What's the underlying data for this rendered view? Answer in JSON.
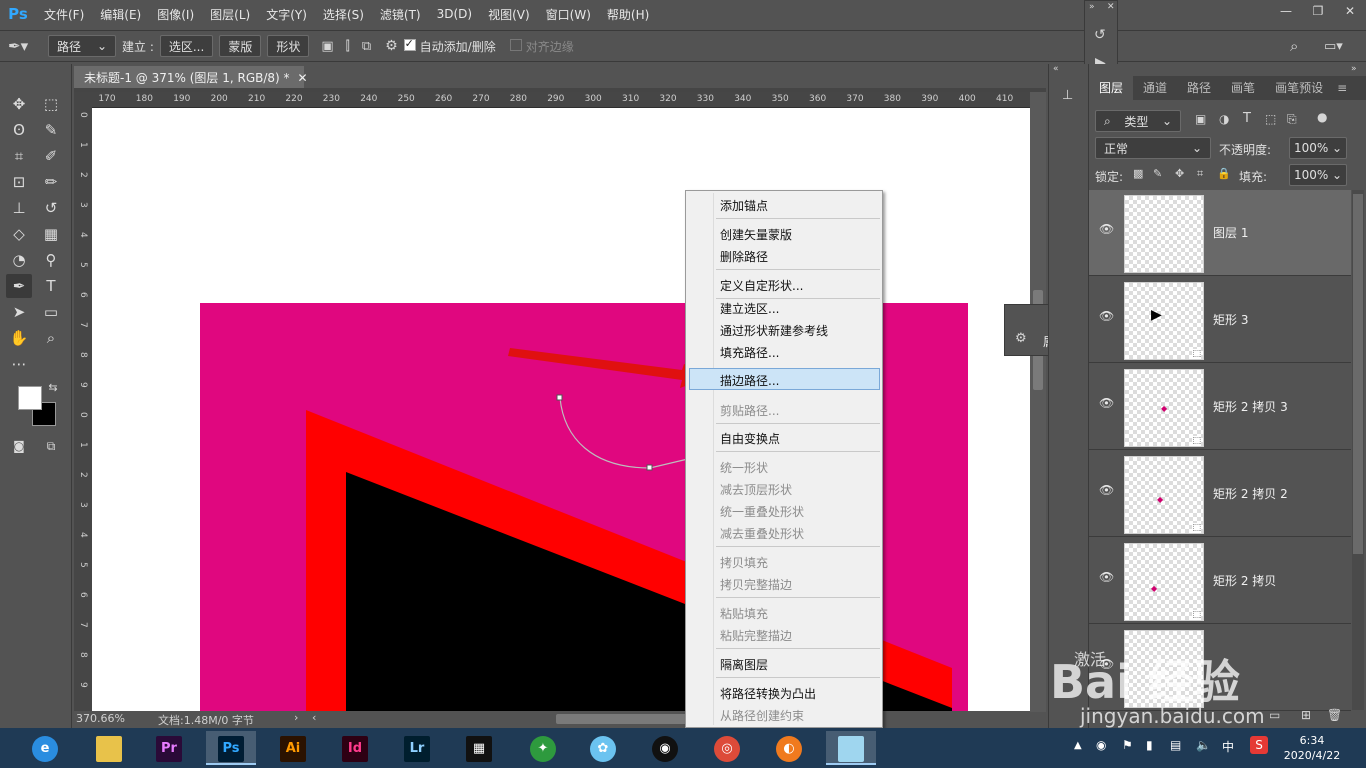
{
  "app": {
    "logo": "Ps"
  },
  "menubar": {
    "items": [
      "文件(F)",
      "编辑(E)",
      "图像(I)",
      "图层(L)",
      "文字(Y)",
      "选择(S)",
      "滤镜(T)",
      "3D(D)",
      "视图(V)",
      "窗口(W)",
      "帮助(H)"
    ]
  },
  "window_controls": {
    "minimize": "—",
    "restore": "❐",
    "close": "✕"
  },
  "options": {
    "mode": "路径",
    "make_label": "建立 :",
    "selection_btn": "选区...",
    "mask_btn": "蒙版",
    "shape_btn": "形状",
    "auto_add_delete": "自动添加/删除",
    "align_edges": "对齐边缘"
  },
  "document": {
    "tab_title": "未标题-1 @ 371% (图层 1, RGB/8) *",
    "zoom": "370.66%",
    "doc_info": "文档:1.48M/0 字节",
    "ruler_h": [
      "170",
      "180",
      "190",
      "200",
      "210",
      "220",
      "230",
      "240",
      "250",
      "260",
      "270",
      "280",
      "290",
      "300",
      "310",
      "320",
      "330",
      "340",
      "350",
      "360",
      "370",
      "380",
      "390",
      "400",
      "410"
    ],
    "ruler_v": [
      "0",
      "1",
      "2",
      "3",
      "4",
      "5",
      "6",
      "7",
      "8",
      "9",
      "0",
      "1",
      "2",
      "3",
      "4",
      "5",
      "6",
      "7",
      "8",
      "9"
    ]
  },
  "context_menu": {
    "items": [
      {
        "label": "添加锚点",
        "disabled": false
      },
      {
        "label": "创建矢量蒙版",
        "disabled": false
      },
      {
        "label": "删除路径",
        "disabled": false
      },
      {
        "label": "定义自定形状...",
        "disabled": false
      },
      {
        "label": "建立选区...",
        "disabled": false
      },
      {
        "label": "通过形状新建参考线",
        "disabled": false
      },
      {
        "label": "填充路径...",
        "disabled": false
      },
      {
        "label": "描边路径...",
        "disabled": false,
        "highlighted": true
      },
      {
        "label": "剪贴路径...",
        "disabled": true
      },
      {
        "label": "自由变换点",
        "disabled": false
      },
      {
        "label": "统一形状",
        "disabled": true
      },
      {
        "label": "减去顶层形状",
        "disabled": true
      },
      {
        "label": "统一重叠处形状",
        "disabled": true
      },
      {
        "label": "减去重叠处形状",
        "disabled": true
      },
      {
        "label": "拷贝填充",
        "disabled": true
      },
      {
        "label": "拷贝完整描边",
        "disabled": true
      },
      {
        "label": "粘贴填充",
        "disabled": true
      },
      {
        "label": "粘贴完整描边",
        "disabled": true
      },
      {
        "label": "隔离图层",
        "disabled": false
      },
      {
        "label": "将路径转换为凸出",
        "disabled": false
      },
      {
        "label": "从路径创建约束",
        "disabled": true
      }
    ]
  },
  "properties_panel": {
    "title": "属性"
  },
  "layers_panel": {
    "tabs": [
      "图层",
      "通道",
      "路径",
      "画笔",
      "画笔预设"
    ],
    "filter_kind": "类型",
    "blend_mode": "正常",
    "opacity_label": "不透明度:",
    "opacity_value": "100%",
    "lock_label": "锁定:",
    "fill_label": "填充:",
    "fill_value": "100%",
    "layers": [
      {
        "name": "图层 1",
        "selected": true
      },
      {
        "name": "矩形 3",
        "selected": false
      },
      {
        "name": "矩形 2 拷贝 3",
        "selected": false
      },
      {
        "name": "矩形 2 拷贝 2",
        "selected": false
      },
      {
        "name": "矩形 2 拷贝",
        "selected": false
      },
      {
        "name": "",
        "selected": false
      }
    ]
  },
  "taskbar": {
    "apps": [
      "Pr",
      "Ps",
      "Ai",
      "Id",
      "Lr"
    ],
    "time": "6:34",
    "date": "2020/4/22",
    "ime": "中"
  },
  "watermark": {
    "logo_text": "Bai 经验",
    "url": "jingyan.baidu.com",
    "activate_text": "激活"
  },
  "colors": {
    "canvas_magenta": "#e0077f",
    "shape_red": "#ff0000",
    "shape_black": "#000000",
    "arrow_red": "#e01010",
    "ps_blue": "#31a8ff"
  }
}
